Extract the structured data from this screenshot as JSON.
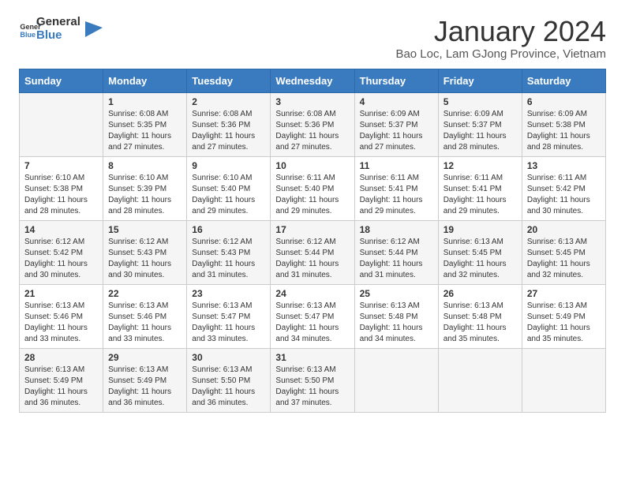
{
  "header": {
    "logo_general": "General",
    "logo_blue": "Blue",
    "title": "January 2024",
    "subtitle": "Bao Loc, Lam GJong Province, Vietnam"
  },
  "calendar": {
    "days_of_week": [
      "Sunday",
      "Monday",
      "Tuesday",
      "Wednesday",
      "Thursday",
      "Friday",
      "Saturday"
    ],
    "weeks": [
      [
        {
          "day": "",
          "sunrise": "",
          "sunset": "",
          "daylight": ""
        },
        {
          "day": "1",
          "sunrise": "Sunrise: 6:08 AM",
          "sunset": "Sunset: 5:35 PM",
          "daylight": "Daylight: 11 hours and 27 minutes."
        },
        {
          "day": "2",
          "sunrise": "Sunrise: 6:08 AM",
          "sunset": "Sunset: 5:36 PM",
          "daylight": "Daylight: 11 hours and 27 minutes."
        },
        {
          "day": "3",
          "sunrise": "Sunrise: 6:08 AM",
          "sunset": "Sunset: 5:36 PM",
          "daylight": "Daylight: 11 hours and 27 minutes."
        },
        {
          "day": "4",
          "sunrise": "Sunrise: 6:09 AM",
          "sunset": "Sunset: 5:37 PM",
          "daylight": "Daylight: 11 hours and 27 minutes."
        },
        {
          "day": "5",
          "sunrise": "Sunrise: 6:09 AM",
          "sunset": "Sunset: 5:37 PM",
          "daylight": "Daylight: 11 hours and 28 minutes."
        },
        {
          "day": "6",
          "sunrise": "Sunrise: 6:09 AM",
          "sunset": "Sunset: 5:38 PM",
          "daylight": "Daylight: 11 hours and 28 minutes."
        }
      ],
      [
        {
          "day": "7",
          "sunrise": "Sunrise: 6:10 AM",
          "sunset": "Sunset: 5:38 PM",
          "daylight": "Daylight: 11 hours and 28 minutes."
        },
        {
          "day": "8",
          "sunrise": "Sunrise: 6:10 AM",
          "sunset": "Sunset: 5:39 PM",
          "daylight": "Daylight: 11 hours and 28 minutes."
        },
        {
          "day": "9",
          "sunrise": "Sunrise: 6:10 AM",
          "sunset": "Sunset: 5:40 PM",
          "daylight": "Daylight: 11 hours and 29 minutes."
        },
        {
          "day": "10",
          "sunrise": "Sunrise: 6:11 AM",
          "sunset": "Sunset: 5:40 PM",
          "daylight": "Daylight: 11 hours and 29 minutes."
        },
        {
          "day": "11",
          "sunrise": "Sunrise: 6:11 AM",
          "sunset": "Sunset: 5:41 PM",
          "daylight": "Daylight: 11 hours and 29 minutes."
        },
        {
          "day": "12",
          "sunrise": "Sunrise: 6:11 AM",
          "sunset": "Sunset: 5:41 PM",
          "daylight": "Daylight: 11 hours and 29 minutes."
        },
        {
          "day": "13",
          "sunrise": "Sunrise: 6:11 AM",
          "sunset": "Sunset: 5:42 PM",
          "daylight": "Daylight: 11 hours and 30 minutes."
        }
      ],
      [
        {
          "day": "14",
          "sunrise": "Sunrise: 6:12 AM",
          "sunset": "Sunset: 5:42 PM",
          "daylight": "Daylight: 11 hours and 30 minutes."
        },
        {
          "day": "15",
          "sunrise": "Sunrise: 6:12 AM",
          "sunset": "Sunset: 5:43 PM",
          "daylight": "Daylight: 11 hours and 30 minutes."
        },
        {
          "day": "16",
          "sunrise": "Sunrise: 6:12 AM",
          "sunset": "Sunset: 5:43 PM",
          "daylight": "Daylight: 11 hours and 31 minutes."
        },
        {
          "day": "17",
          "sunrise": "Sunrise: 6:12 AM",
          "sunset": "Sunset: 5:44 PM",
          "daylight": "Daylight: 11 hours and 31 minutes."
        },
        {
          "day": "18",
          "sunrise": "Sunrise: 6:12 AM",
          "sunset": "Sunset: 5:44 PM",
          "daylight": "Daylight: 11 hours and 31 minutes."
        },
        {
          "day": "19",
          "sunrise": "Sunrise: 6:13 AM",
          "sunset": "Sunset: 5:45 PM",
          "daylight": "Daylight: 11 hours and 32 minutes."
        },
        {
          "day": "20",
          "sunrise": "Sunrise: 6:13 AM",
          "sunset": "Sunset: 5:45 PM",
          "daylight": "Daylight: 11 hours and 32 minutes."
        }
      ],
      [
        {
          "day": "21",
          "sunrise": "Sunrise: 6:13 AM",
          "sunset": "Sunset: 5:46 PM",
          "daylight": "Daylight: 11 hours and 33 minutes."
        },
        {
          "day": "22",
          "sunrise": "Sunrise: 6:13 AM",
          "sunset": "Sunset: 5:46 PM",
          "daylight": "Daylight: 11 hours and 33 minutes."
        },
        {
          "day": "23",
          "sunrise": "Sunrise: 6:13 AM",
          "sunset": "Sunset: 5:47 PM",
          "daylight": "Daylight: 11 hours and 33 minutes."
        },
        {
          "day": "24",
          "sunrise": "Sunrise: 6:13 AM",
          "sunset": "Sunset: 5:47 PM",
          "daylight": "Daylight: 11 hours and 34 minutes."
        },
        {
          "day": "25",
          "sunrise": "Sunrise: 6:13 AM",
          "sunset": "Sunset: 5:48 PM",
          "daylight": "Daylight: 11 hours and 34 minutes."
        },
        {
          "day": "26",
          "sunrise": "Sunrise: 6:13 AM",
          "sunset": "Sunset: 5:48 PM",
          "daylight": "Daylight: 11 hours and 35 minutes."
        },
        {
          "day": "27",
          "sunrise": "Sunrise: 6:13 AM",
          "sunset": "Sunset: 5:49 PM",
          "daylight": "Daylight: 11 hours and 35 minutes."
        }
      ],
      [
        {
          "day": "28",
          "sunrise": "Sunrise: 6:13 AM",
          "sunset": "Sunset: 5:49 PM",
          "daylight": "Daylight: 11 hours and 36 minutes."
        },
        {
          "day": "29",
          "sunrise": "Sunrise: 6:13 AM",
          "sunset": "Sunset: 5:49 PM",
          "daylight": "Daylight: 11 hours and 36 minutes."
        },
        {
          "day": "30",
          "sunrise": "Sunrise: 6:13 AM",
          "sunset": "Sunset: 5:50 PM",
          "daylight": "Daylight: 11 hours and 36 minutes."
        },
        {
          "day": "31",
          "sunrise": "Sunrise: 6:13 AM",
          "sunset": "Sunset: 5:50 PM",
          "daylight": "Daylight: 11 hours and 37 minutes."
        },
        {
          "day": "",
          "sunrise": "",
          "sunset": "",
          "daylight": ""
        },
        {
          "day": "",
          "sunrise": "",
          "sunset": "",
          "daylight": ""
        },
        {
          "day": "",
          "sunrise": "",
          "sunset": "",
          "daylight": ""
        }
      ]
    ]
  }
}
